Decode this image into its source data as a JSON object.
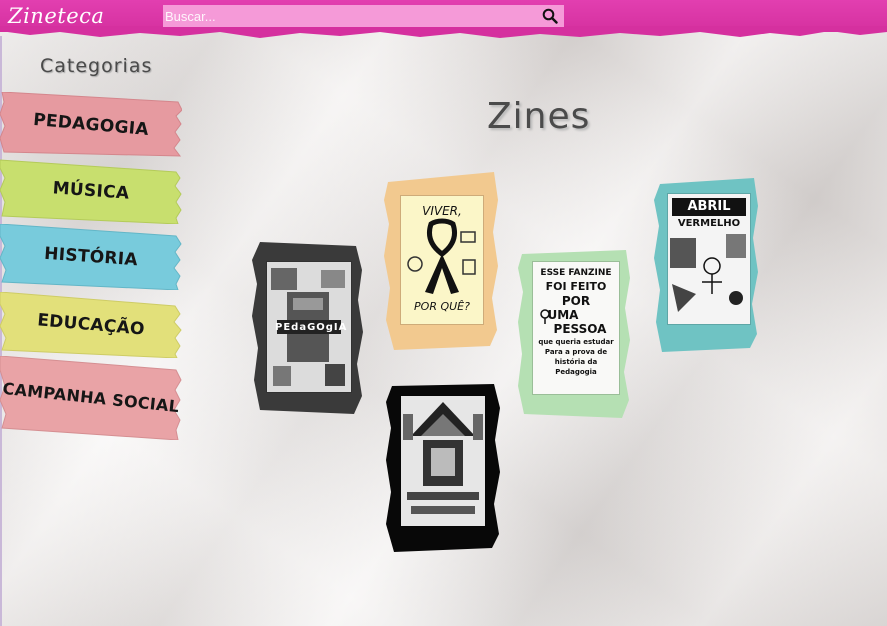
{
  "app": {
    "logo": "Zineteca",
    "search": {
      "placeholder": "Buscar...",
      "value": ""
    }
  },
  "sidebar": {
    "title": "Categorias",
    "items": [
      {
        "label": "PEDAGOGIA",
        "color": "#e69aa0"
      },
      {
        "label": "MÚSICA",
        "color": "#c8df6e"
      },
      {
        "label": "HISTÓRIA",
        "color": "#78cbdc"
      },
      {
        "label": "EDUCAÇÃO",
        "color": "#e2e07a"
      },
      {
        "label": "CAMPANHA SOCIAL",
        "color": "#e9a3a6"
      }
    ]
  },
  "main": {
    "title": "Zines",
    "zines": [
      {
        "frame": "dark-gray",
        "cover": {
          "lines": [
            "PEdaGOgIA"
          ]
        }
      },
      {
        "frame": "orange",
        "cover": {
          "lines": [
            "VIVER,",
            "POR QUÊ?"
          ]
        }
      },
      {
        "frame": "green",
        "cover": {
          "lines": [
            "ESSE FANZINE",
            "FOI FEITO",
            "POR",
            "UMA",
            "PESSOA",
            "que queria estudar",
            "Para a prova de",
            "história da",
            "Pedagogia"
          ]
        }
      },
      {
        "frame": "teal",
        "cover": {
          "lines": [
            "ABRIL",
            "VERMELHO"
          ]
        }
      },
      {
        "frame": "black",
        "cover": {
          "lines": []
        }
      }
    ]
  },
  "colors": {
    "topbar": "#d5309f",
    "search_bg": "#f59ad8",
    "frame_dark": "#3a3a3a",
    "frame_orange": "#f2c98f",
    "frame_green": "#b5e0b3",
    "frame_teal": "#6fc3c3",
    "frame_black": "#080808"
  }
}
